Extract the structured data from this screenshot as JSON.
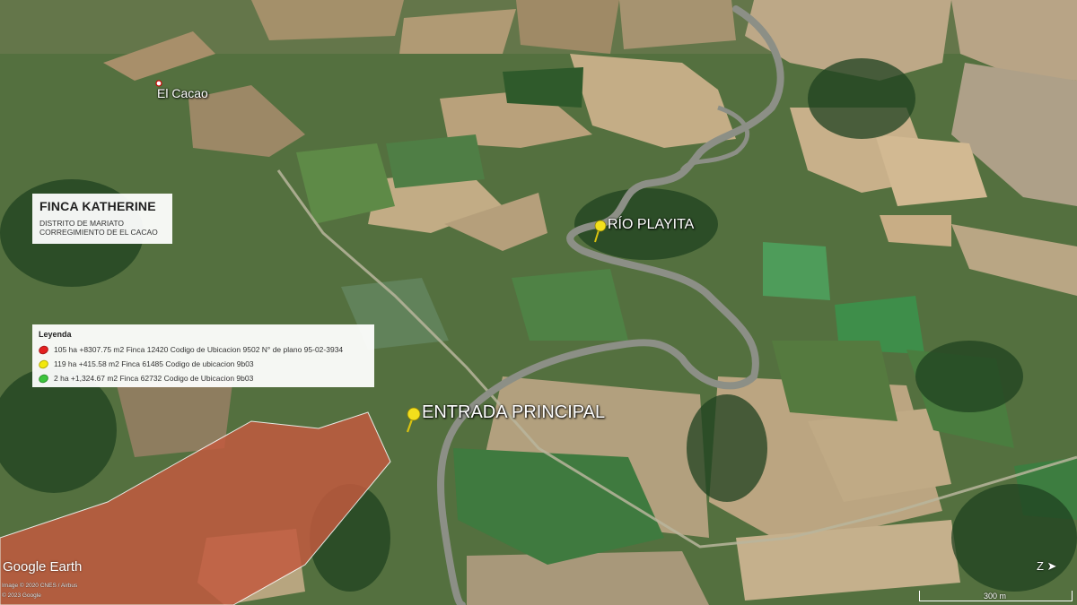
{
  "map": {
    "places": {
      "el_cacao": "El Cacao",
      "rio_playita": "RÍO PLAYITA",
      "entrada_principal": "ENTRADA PRINCIPAL"
    },
    "title_box": {
      "title": "FINCA KATHERINE",
      "line1": "DISTRITO DE MARIATO",
      "line2": "CORREGIMIENTO DE EL CACAO"
    },
    "legend": {
      "heading": "Leyenda",
      "items": [
        {
          "label": "105 ha +8307.75 m2 Finca 12420 Codigo de Ubicacion 9502 N° de plano 95-02-3934",
          "color": "#e32020"
        },
        {
          "label": "119 ha +415.58 m2 Finca 61485 Codigo de ubicacion 9b03",
          "color": "#f2e80d"
        },
        {
          "label": "2 ha +1,324.67 m2 Finca 62732 Codigo de Ubicacion 9b03",
          "color": "#3cc43c"
        }
      ]
    },
    "brand": "Google Earth",
    "credits": {
      "line1": "Image © 2020 CNES / Airbus",
      "line2": "© 2023 Google"
    },
    "compass": "Z ➤",
    "scale_label": "300 m",
    "colors": {
      "red_parcel": "#c25a3f",
      "pin_yellow": "#f2df1c",
      "river_gray": "#8c8f86"
    }
  }
}
